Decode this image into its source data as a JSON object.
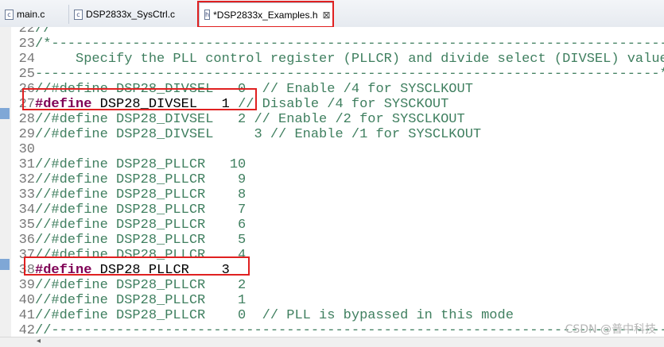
{
  "tabs": [
    {
      "label": "main.c",
      "icon": "c-file-icon",
      "active": false
    },
    {
      "label": "DSP2833x_SysCtrl.c",
      "icon": "c-file-icon",
      "active": false
    },
    {
      "label": "*DSP2833x_Examples.h",
      "icon": "h-file-icon",
      "active": true
    }
  ],
  "icon_glyphs": {
    "c": "c",
    "h": "h",
    "close": "⊠"
  },
  "colors": {
    "comment": "#3f7f5f",
    "keyword": "#7f0055",
    "highlight": "#e02020"
  },
  "code_lines": [
    {
      "n": "22",
      "parts": [
        {
          "t": "//",
          "c": "cm"
        }
      ]
    },
    {
      "n": "23",
      "parts": [
        {
          "t": "/*-----------------------------------------------------------------------------",
          "c": "cm"
        }
      ]
    },
    {
      "n": "24",
      "parts": [
        {
          "t": "     Specify the PLL control register (PLLCR) and divide select (DIVSEL) value.",
          "c": "cm"
        }
      ]
    },
    {
      "n": "25",
      "parts": [
        {
          "t": "-----------------------------------------------------------------------------*/",
          "c": "cm"
        }
      ]
    },
    {
      "n": "26",
      "parts": [
        {
          "t": "//#define DSP28_DIVSEL   0  // Enable /4 for SYSCLKOUT",
          "c": "cm"
        }
      ]
    },
    {
      "n": "27",
      "parts": [
        {
          "t": "#define",
          "c": "kw"
        },
        {
          "t": " DSP28_DIVSEL   1 ",
          "c": "tx"
        },
        {
          "t": "// Disable /4 for SYSCKOUT",
          "c": "cm"
        }
      ]
    },
    {
      "n": "28",
      "parts": [
        {
          "t": "//#define DSP28_DIVSEL   2 // Enable /2 for SYSCLKOUT",
          "c": "cm"
        }
      ]
    },
    {
      "n": "29",
      "parts": [
        {
          "t": "//#define DSP28_DIVSEL     3 // Enable /1 for SYSCLKOUT",
          "c": "cm"
        }
      ]
    },
    {
      "n": "30",
      "parts": []
    },
    {
      "n": "31",
      "parts": [
        {
          "t": "//#define DSP28_PLLCR   10",
          "c": "cm"
        }
      ]
    },
    {
      "n": "32",
      "parts": [
        {
          "t": "//#define DSP28_PLLCR    9",
          "c": "cm"
        }
      ]
    },
    {
      "n": "33",
      "parts": [
        {
          "t": "//#define DSP28_PLLCR    8",
          "c": "cm"
        }
      ]
    },
    {
      "n": "34",
      "parts": [
        {
          "t": "//#define DSP28_PLLCR    7",
          "c": "cm"
        }
      ]
    },
    {
      "n": "35",
      "parts": [
        {
          "t": "//#define DSP28_PLLCR    6",
          "c": "cm"
        }
      ]
    },
    {
      "n": "36",
      "parts": [
        {
          "t": "//#define DSP28_PLLCR    5",
          "c": "cm"
        }
      ]
    },
    {
      "n": "37",
      "parts": [
        {
          "t": "//#define DSP28_PLLCR    4",
          "c": "cm"
        }
      ]
    },
    {
      "n": "38",
      "parts": [
        {
          "t": "#define",
          "c": "kw"
        },
        {
          "t": " DSP28_PLLCR    3",
          "c": "tx"
        }
      ]
    },
    {
      "n": "39",
      "parts": [
        {
          "t": "//#define DSP28_PLLCR    2",
          "c": "cm"
        }
      ]
    },
    {
      "n": "40",
      "parts": [
        {
          "t": "//#define DSP28_PLLCR    1",
          "c": "cm"
        }
      ]
    },
    {
      "n": "41",
      "parts": [
        {
          "t": "//#define DSP28_PLLCR    0  // PLL is bypassed in this mode",
          "c": "cm"
        }
      ]
    },
    {
      "n": "42",
      "parts": [
        {
          "t": "//-----------------------------------------------------------------------------",
          "c": "cm"
        }
      ]
    }
  ],
  "watermark": "CSDN @普中科技"
}
